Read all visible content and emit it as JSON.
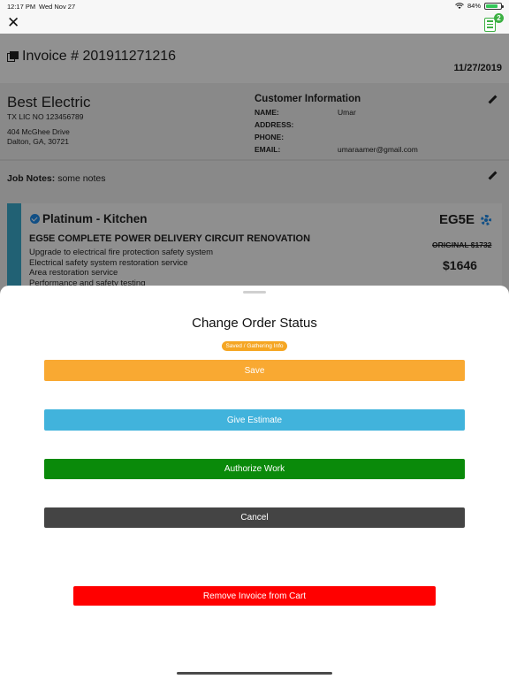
{
  "status_bar": {
    "time": "12:17 PM",
    "date": "Wed Nov 27",
    "battery": "84%",
    "battery_level": 0.84
  },
  "nav": {
    "close_icon": "close-x-icon",
    "cart_icon": "invoice-cart-icon",
    "cart_count": "2"
  },
  "invoice": {
    "title": "Invoice # 201911271216",
    "date": "11/27/2019",
    "company": {
      "name": "Best Electric",
      "license": "TX LIC NO 123456789",
      "address_line1": "404 McGhee Drive",
      "address_line2": "Dalton, GA, 30721"
    },
    "customer": {
      "heading": "Customer Information",
      "name_label": "NAME:",
      "name_value": "Umar",
      "address_label": "ADDRESS:",
      "address_value": "",
      "phone_label": "PHONE:",
      "phone_value": "",
      "email_label": "EMAIL:",
      "email_value": "umaraamer@gmail.com"
    },
    "job_notes_label": "Job Notes:",
    "job_notes_value": "some notes",
    "product": {
      "tier": "Platinum - Kitchen",
      "code": "EG5E",
      "name": "EG5E COMPLETE POWER DELIVERY CIRCUIT RENOVATION",
      "features": [
        "Upgrade to electrical fire protection safety system",
        "Electrical safety system restoration service",
        "Area restoration service",
        "Performance and safety testing"
      ],
      "original_price": "ORIGINAL $1732",
      "price": "$1646"
    }
  },
  "sheet": {
    "title": "Change Order Status",
    "status_badge": "Saved / Gathering Info",
    "buttons": {
      "save": "Save",
      "give_estimate": "Give Estimate",
      "authorize_work": "Authorize Work",
      "cancel": "Cancel",
      "remove": "Remove Invoice from Cart"
    }
  },
  "colors": {
    "save": "#f9a932",
    "estimate": "#41b3dc",
    "authorize": "#0a8a0a",
    "cancel": "#444444",
    "remove": "#ff0000",
    "badge": "#f5a623",
    "accent_stripe": "#3aa8c8"
  }
}
